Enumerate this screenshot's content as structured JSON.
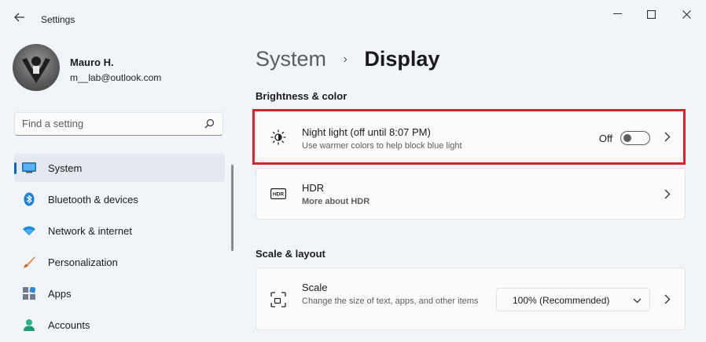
{
  "window": {
    "title": "Settings"
  },
  "user": {
    "name": "Mauro H.",
    "email": "m__lab@outlook.com"
  },
  "search": {
    "placeholder": "Find a setting"
  },
  "sidebar": {
    "items": [
      {
        "label": "System",
        "icon": "monitor-icon",
        "active": true
      },
      {
        "label": "Bluetooth & devices",
        "icon": "bluetooth-icon"
      },
      {
        "label": "Network & internet",
        "icon": "wifi-icon"
      },
      {
        "label": "Personalization",
        "icon": "brush-icon"
      },
      {
        "label": "Apps",
        "icon": "apps-icon"
      },
      {
        "label": "Accounts",
        "icon": "person-icon"
      }
    ]
  },
  "breadcrumb": {
    "parent": "System",
    "separator": "›",
    "current": "Display"
  },
  "sections": {
    "brightness": {
      "header": "Brightness & color",
      "night_light": {
        "title": "Night light (off until 8:07 PM)",
        "subtitle": "Use warmer colors to help block blue light",
        "toggle_label": "Off",
        "toggle_on": false
      },
      "hdr": {
        "title": "HDR",
        "link": "More about HDR"
      }
    },
    "scale": {
      "header": "Scale & layout",
      "scale_card": {
        "title": "Scale",
        "subtitle": "Change the size of text, apps, and other items",
        "selected": "100% (Recommended)"
      }
    }
  },
  "colors": {
    "accent": "#0067c0",
    "highlight": "#d7252c",
    "link": "#004c99"
  }
}
